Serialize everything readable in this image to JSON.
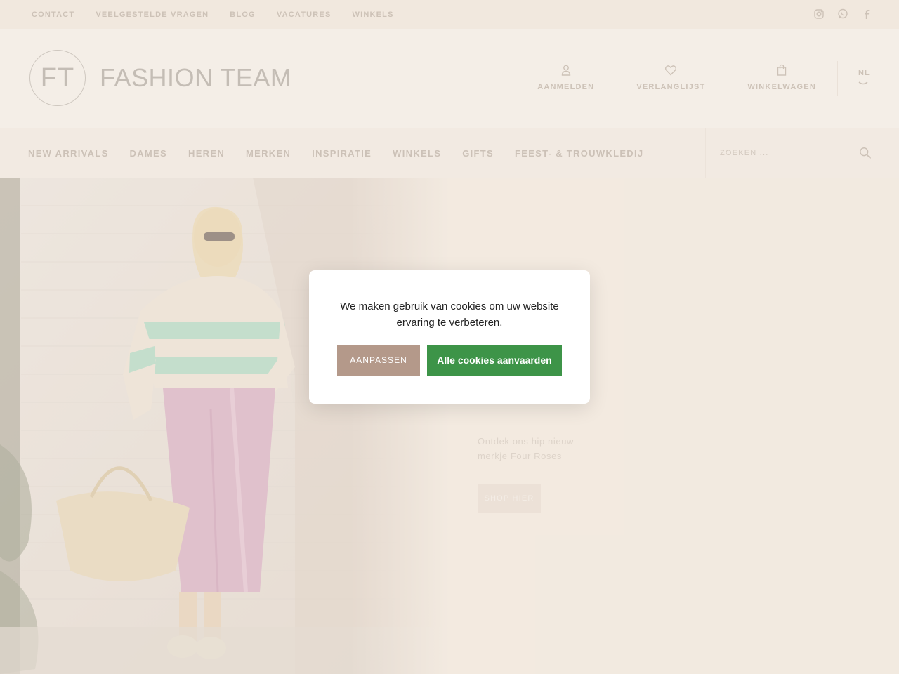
{
  "topbar": {
    "links": [
      "CONTACT",
      "VEELGESTELDE VRAGEN",
      "BLOG",
      "VACATURES",
      "WINKELS"
    ],
    "social_icons": [
      "instagram-icon",
      "whatsapp-icon",
      "facebook-icon"
    ]
  },
  "header": {
    "logo_monogram": "FT",
    "logo_wordmark": "FASHION TEAM",
    "actions": [
      {
        "label": "AANMELDEN",
        "icon": "user-icon"
      },
      {
        "label": "VERLANGLIJST",
        "icon": "heart-icon"
      },
      {
        "label": "WINKELWAGEN",
        "icon": "bag-icon"
      }
    ],
    "language": "NL"
  },
  "nav": {
    "items": [
      "NEW ARRIVALS",
      "DAMES",
      "HEREN",
      "MERKEN",
      "INSPIRATIE",
      "WINKELS",
      "GIFTS",
      "FEEST- & TROUWKLEDIJ"
    ],
    "search_placeholder": "ZOEKEN ..."
  },
  "hero": {
    "text": "Ontdek ons hip nieuw merkje Four Roses",
    "button_label": "SHOP HIER"
  },
  "cookie_modal": {
    "message": "We maken gebruik van cookies om uw website ervaring te verbeteren.",
    "adjust_label": "AANPASSEN",
    "accept_label": "Alle cookies aanvaarden"
  },
  "colors": {
    "accept_button": "#3d9448",
    "adjust_button": "#b4998a",
    "background": "#f2ece4"
  }
}
